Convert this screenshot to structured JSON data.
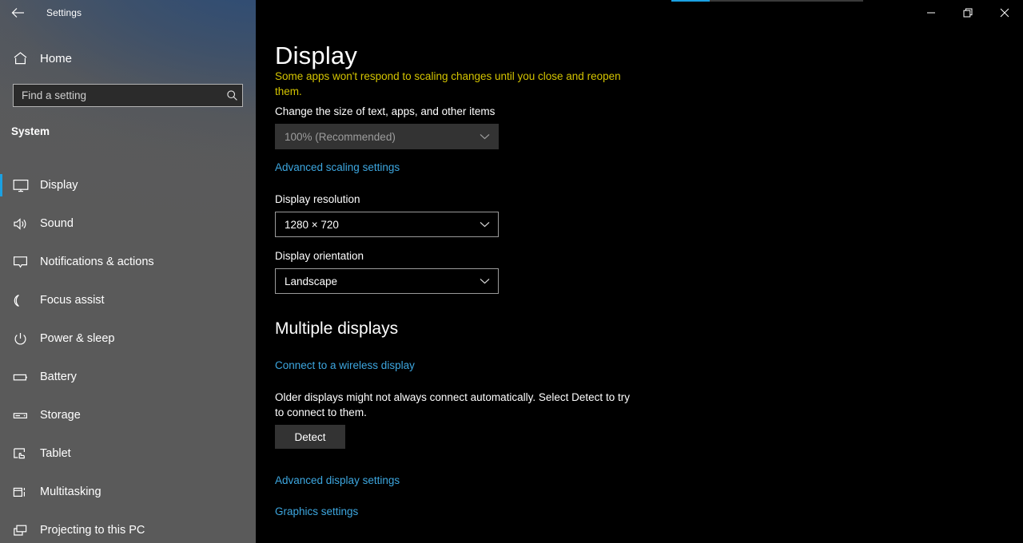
{
  "window": {
    "title": "Settings",
    "back_icon": "back-arrow-icon",
    "controls": [
      {
        "name": "minimize",
        "glyph": "—"
      },
      {
        "name": "restore",
        "glyph": "❐"
      },
      {
        "name": "close",
        "glyph": "✕"
      }
    ]
  },
  "sidebar": {
    "home_label": "Home",
    "home_icon": "home-icon",
    "search": {
      "placeholder": "Find a setting",
      "value": "",
      "icon": "search-icon"
    },
    "section_label": "System",
    "accent_color": "#1ba1e2",
    "items": [
      {
        "label": "Display",
        "icon": "monitor-icon",
        "selected": true
      },
      {
        "label": "Sound",
        "icon": "speaker-icon",
        "selected": false
      },
      {
        "label": "Notifications & actions",
        "icon": "notification-icon",
        "selected": false
      },
      {
        "label": "Focus assist",
        "icon": "moon-icon",
        "selected": false
      },
      {
        "label": "Power & sleep",
        "icon": "power-icon",
        "selected": false
      },
      {
        "label": "Battery",
        "icon": "battery-icon",
        "selected": false
      },
      {
        "label": "Storage",
        "icon": "storage-icon",
        "selected": false
      },
      {
        "label": "Tablet",
        "icon": "tablet-icon",
        "selected": false
      },
      {
        "label": "Multitasking",
        "icon": "multitasking-icon",
        "selected": false
      },
      {
        "label": "Projecting to this PC",
        "icon": "projecting-icon",
        "selected": false
      }
    ]
  },
  "main": {
    "page_title": "Display",
    "scale_warning": "Some apps won't respond to scaling changes until you close and reopen them.",
    "scale_label": "Change the size of text, apps, and other items",
    "scale_value": "100% (Recommended)",
    "advanced_scaling_link": "Advanced scaling settings",
    "resolution_label": "Display resolution",
    "resolution_value": "1280 × 720",
    "orientation_label": "Display orientation",
    "orientation_value": "Landscape",
    "multiple_displays_title": "Multiple displays",
    "wireless_display_link": "Connect to a wireless display",
    "older_displays_text": "Older displays might not always connect automatically. Select Detect to try to connect to them.",
    "detect_button": "Detect",
    "advanced_display_link": "Advanced display settings",
    "graphics_settings_link": "Graphics settings"
  }
}
